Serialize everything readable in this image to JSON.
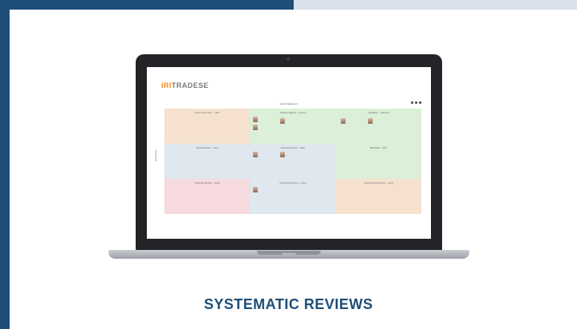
{
  "app": {
    "logo": {
      "accent": "IRI",
      "text": "TRADESE"
    },
    "page_title": "Head Category A"
  },
  "screen_grid": {
    "side_label": "Methodology",
    "cells": [
      {
        "label": "Lorem Ipsum Dolor — 2024",
        "color": "#f6e1cf"
      },
      {
        "label": "Evidence Mapping — Review",
        "color": "#dcefd8"
      },
      {
        "label": "Qualitative — Data Set",
        "color": "#dcefd8"
      },
      {
        "label": "Pooled Analysis — Study",
        "color": "#dfe7ef"
      },
      {
        "label": "Screening Criteria — Study",
        "color": "#dfe7ef"
      },
      {
        "label": "Meta Data — 2024",
        "color": "#dcefd8"
      },
      {
        "label": "Systematic Review — Study",
        "color": "#f6dadd"
      },
      {
        "label": "Comparative Review — Study",
        "color": "#dfe7ef"
      },
      {
        "label": "Cross-Sectional Review — Study",
        "color": "#f6e1cf"
      }
    ]
  },
  "laptop": {
    "brand": "MacBook"
  },
  "caption": "SYSTEMATIC REVIEWS",
  "colors": {
    "navy": "#1d4e78",
    "light_band": "#d9e2ea",
    "accent_orange": "#f08a1c"
  }
}
